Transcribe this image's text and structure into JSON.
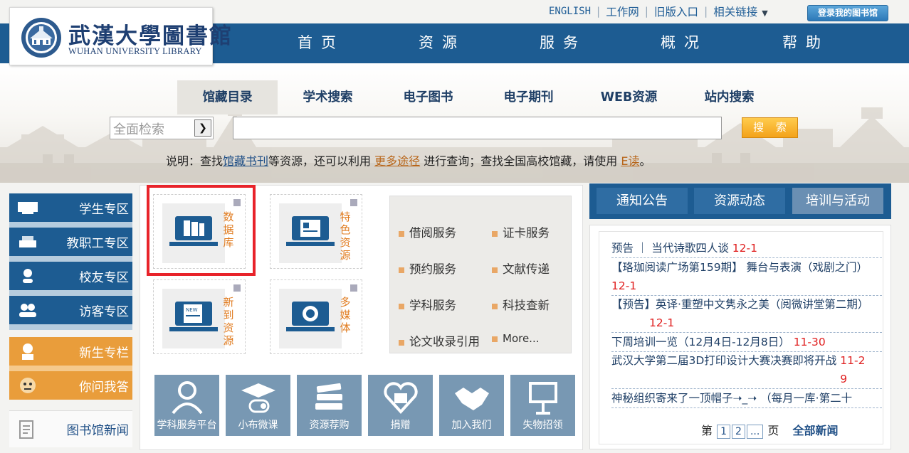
{
  "header": {
    "logo_cn": "武漢大學圖書館",
    "logo_en": "WUHAN UNIVERSITY LIBRARY",
    "top_links": [
      "ENGLISH",
      "工作网",
      "旧版入口",
      "相关链接"
    ],
    "login_label": "登录我的图书馆",
    "nav": [
      "首页",
      "资源",
      "服务",
      "概况",
      "帮助"
    ]
  },
  "search": {
    "tabs": [
      "馆藏目录",
      "学术搜索",
      "电子图书",
      "电子期刊",
      "WEB资源",
      "站内搜索"
    ],
    "active_tab": "馆藏目录",
    "scope_value": "全面检索",
    "query_value": "",
    "button_label": "搜 索",
    "note": {
      "p1": "说明：查找",
      "link1": "馆藏书刊",
      "p2": "等资源，还可以利用 ",
      "link2": "更多途径",
      "p3": " 进行查询；查找全国高校馆藏，请使用 ",
      "link3": "E读",
      "p4": "。"
    }
  },
  "left_nav": {
    "items": [
      {
        "label": "学生专区",
        "icon": "student-icon"
      },
      {
        "label": "教职工专区",
        "icon": "faculty-icon"
      },
      {
        "label": "校友专区",
        "icon": "alumni-icon"
      },
      {
        "label": "访客专区",
        "icon": "visitor-icon"
      },
      {
        "label": "新生专栏",
        "icon": "freshman-icon"
      },
      {
        "label": "你问我答",
        "icon": "qa-icon"
      }
    ],
    "news_label": "图书馆新闻"
  },
  "resources": {
    "tiles": [
      "数据库",
      "特色资源",
      "新到资源",
      "多媒体"
    ]
  },
  "services": {
    "items": [
      "借阅服务",
      "证卡服务",
      "预约服务",
      "文献传递",
      "学科服务",
      "科技查新",
      "论文收录引用",
      "More..."
    ]
  },
  "quick_buttons": [
    "学科服务平台",
    "小布微课",
    "资源荐购",
    "捐赠",
    "加入我们",
    "失物招领"
  ],
  "notices": {
    "tabs": [
      "通知公告",
      "资源动态",
      "培训与活动"
    ],
    "active_tab": "培训与活动",
    "items": [
      {
        "title": "预告 ｜ 当代诗歌四人谈",
        "date": "12-1"
      },
      {
        "title": "【珞珈阅读广场第159期】 舞台与表演（戏剧之门）",
        "date": "12-1"
      },
      {
        "title": "【预告】英译·重塑中文隽永之美（阅微讲堂第二期）",
        "date": "12-1"
      },
      {
        "title": "下周培训一览（12月4日-12月8日）",
        "date": "11-30"
      },
      {
        "title": "武汉大学第二届3D打印设计大赛决赛即将开战",
        "date": "11-29"
      },
      {
        "title": "神秘组织寄来了一顶帽子➝_➝ （每月一库·第二十",
        "date": ""
      }
    ],
    "pager": {
      "prefix": "第",
      "pages": [
        "1",
        "2",
        "..."
      ],
      "suffix": "页",
      "all_label": "全部新闻"
    }
  },
  "colors": {
    "primary": "#1d5c92",
    "accent_orange": "#e99d3b",
    "highlight_red": "#e8232a",
    "date_red": "#e02020"
  }
}
